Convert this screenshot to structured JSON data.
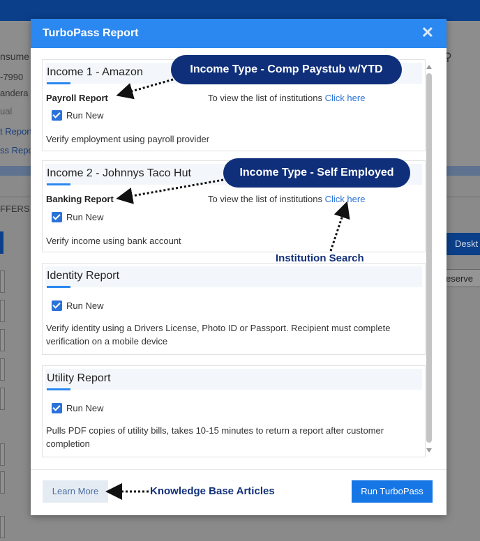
{
  "background": {
    "texts": [
      "nsume",
      "-7990",
      "andera l",
      "ual",
      "t Report",
      "ss Repo",
      "FFERS",
      "Deskt",
      "eserve"
    ]
  },
  "modal": {
    "title": "TurboPass Report",
    "close_icon": "close-icon",
    "sections": [
      {
        "title": "Income 1 - Amazon",
        "report": "Payroll Report",
        "institutions_text": "To view the list of institutions",
        "institutions_link": "Click here",
        "checkbox_label": "Run New",
        "checked": true,
        "description": "Verify employment using payroll provider"
      },
      {
        "title": "Income 2 - Johnnys Taco Hut",
        "report": "Banking Report",
        "institutions_text": "To view the list of institutions",
        "institutions_link": "Click here",
        "checkbox_label": "Run New",
        "checked": true,
        "description": "Verify income using bank account"
      },
      {
        "title": "Identity Report",
        "checkbox_label": "Run New",
        "checked": true,
        "description": "Verify identity using a Drivers License, Photo ID or Passport. Recipient must complete verification on a mobile device"
      },
      {
        "title": "Utility Report",
        "checkbox_label": "Run New",
        "checked": true,
        "description": "Pulls PDF copies of utility bills, takes 10-15 minutes to return a report after customer completion"
      }
    ],
    "learn_more_label": "Learn More",
    "run_label": "Run TurboPass"
  },
  "annotations": {
    "income_type_1": "Income Type - Comp Paystub w/YTD",
    "income_type_2": "Income Type - Self Employed",
    "institution_search": "Institution Search",
    "knowledge_base": "Knowledge Base Articles"
  },
  "colors": {
    "header_blue": "#2b88f0",
    "annotation_navy": "#0f2f7a",
    "button_blue": "#1676e6"
  }
}
